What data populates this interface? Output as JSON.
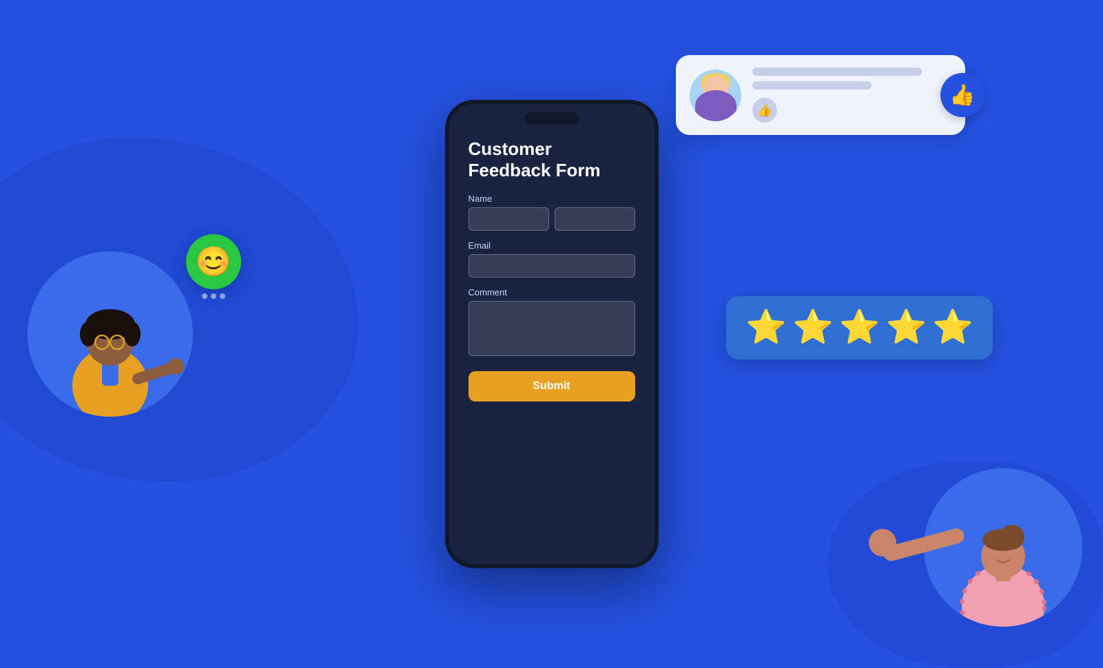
{
  "background": {
    "color": "#2451e0"
  },
  "form": {
    "title_line1": "Customer",
    "title_line2": "Feedback Form",
    "name_label": "Name",
    "email_label": "Email",
    "comment_label": "Comment",
    "submit_label": "Submit"
  },
  "stars_card": {
    "stars": [
      "⭐",
      "⭐",
      "⭐",
      "⭐",
      "⭐"
    ]
  },
  "profile_card": {
    "thumb_icon": "👍"
  },
  "emoji_bubble": {
    "emoji": "😊"
  },
  "thumb_big": {
    "icon": "👍"
  }
}
